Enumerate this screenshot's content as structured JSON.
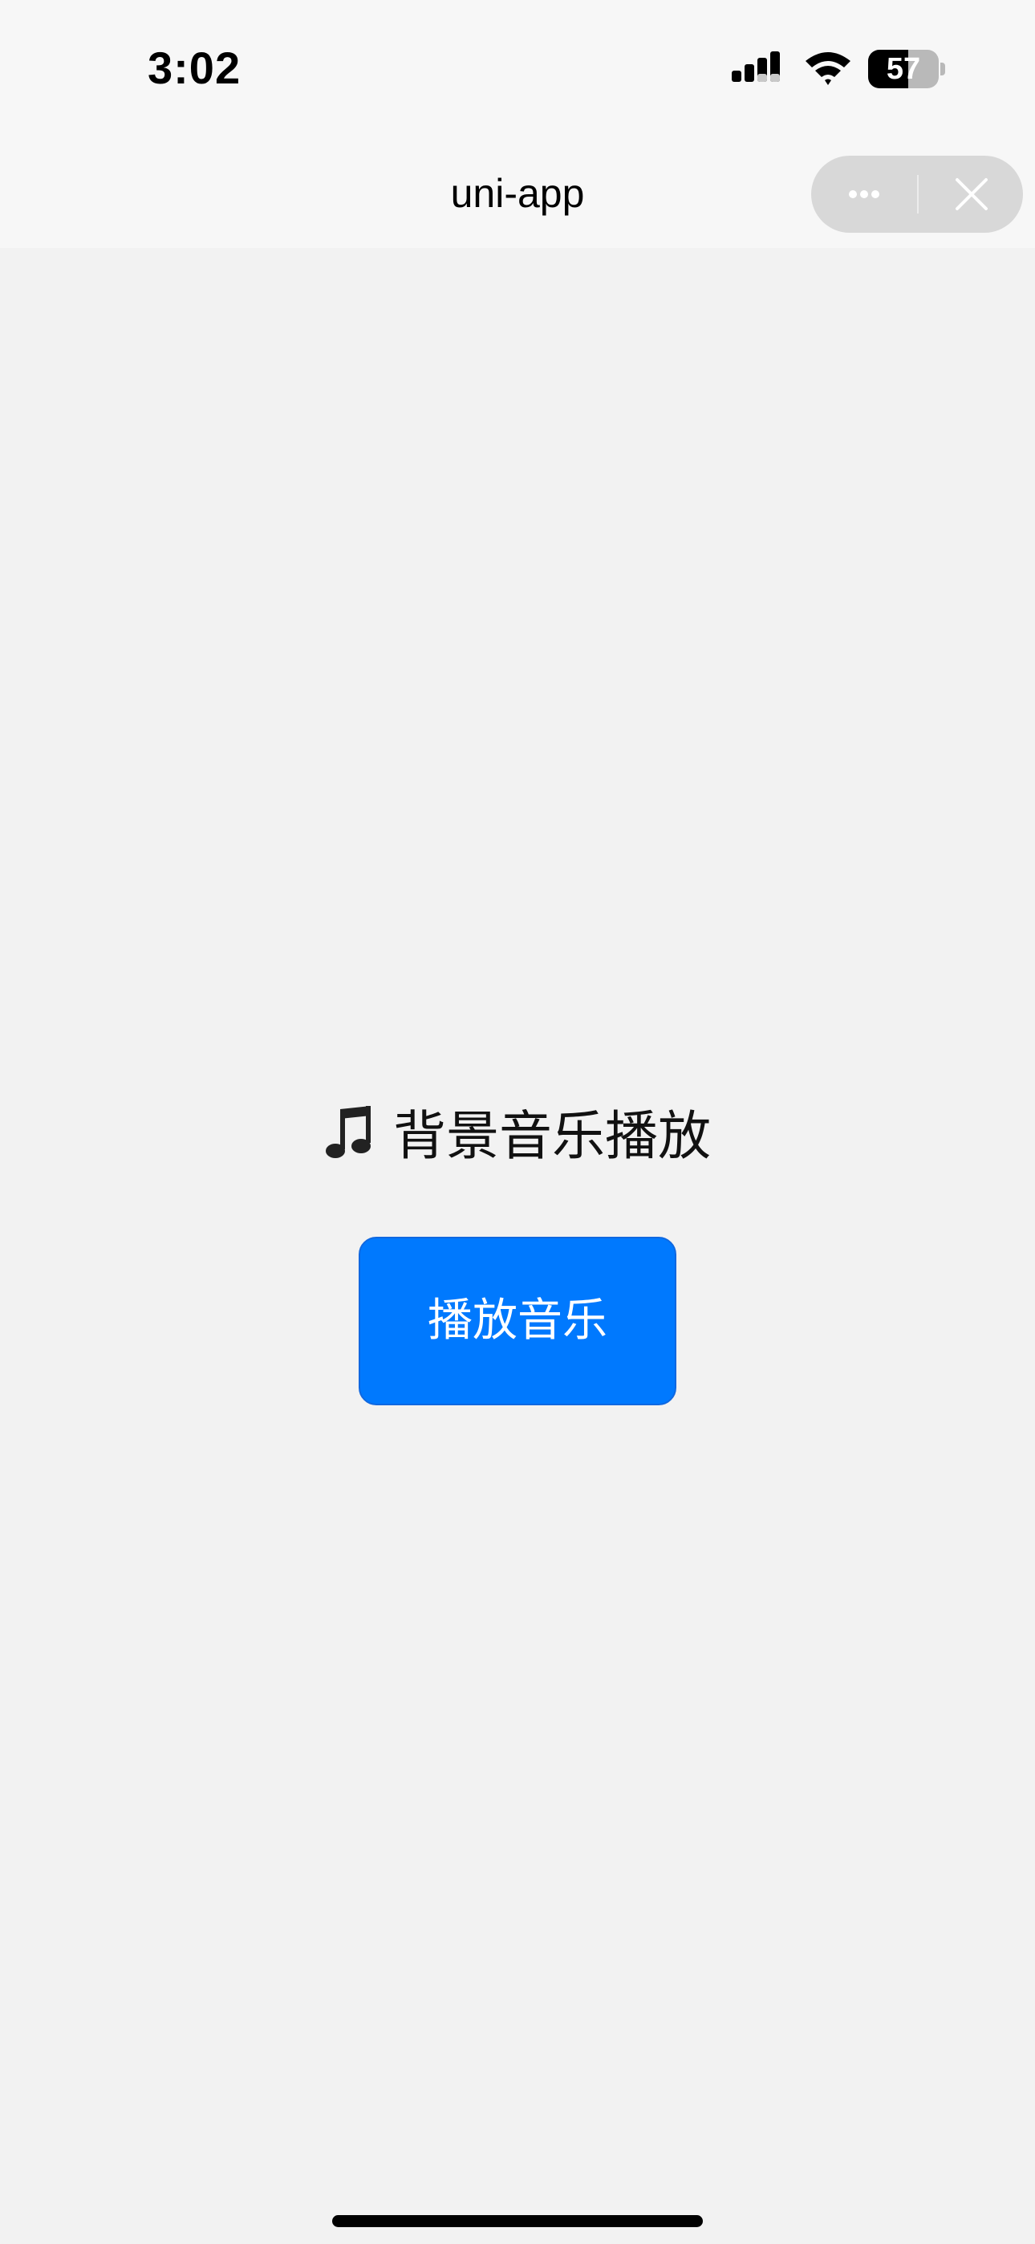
{
  "status_bar": {
    "time": "3:02",
    "battery_level": "57",
    "battery_fraction": 0.57
  },
  "nav": {
    "title": "uni-app",
    "more_icon": "more-dots-icon",
    "close_icon": "close-icon"
  },
  "content": {
    "title": "背景音乐播放",
    "title_icon": "music-note-icon",
    "play_button_label": "播放音乐"
  },
  "colors": {
    "accent": "#0079fe",
    "page_background": "#f2f2f2",
    "header_background": "#f7f7f7"
  }
}
